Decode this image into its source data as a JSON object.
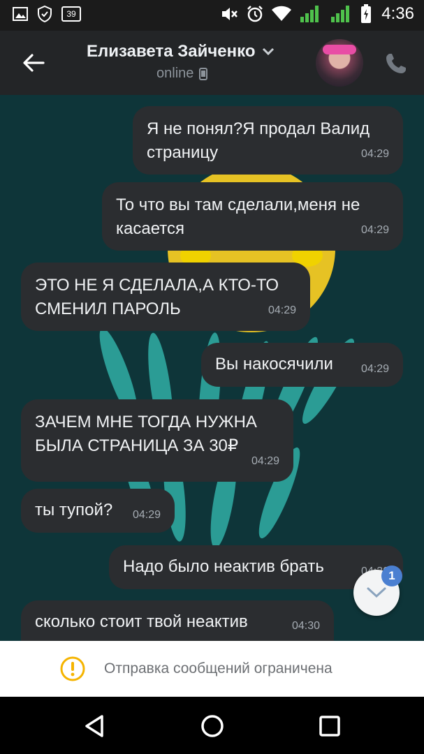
{
  "status_bar": {
    "badge": "39",
    "time": "4:36"
  },
  "header": {
    "name": "Елизавета Зайченко",
    "status": "online"
  },
  "messages": [
    {
      "text": "Я не понял?Я продал Валид страницу",
      "time": "04:29",
      "direction": "outgoing"
    },
    {
      "text": "То что вы там сделали,меня не касается",
      "time": "04:29",
      "direction": "outgoing"
    },
    {
      "text": "ЭТО НЕ Я СДЕЛАЛА,А КТО-ТО СМЕНИЛ ПАРОЛЬ",
      "time": "04:29",
      "direction": "incoming"
    },
    {
      "text": "Вы накосячили",
      "time": "04:29",
      "direction": "outgoing"
    },
    {
      "text": "ЗАЧЕМ МНЕ ТОГДА НУЖНА БЫЛА СТРАНИЦА ЗА 30₽",
      "time": "04:29",
      "direction": "incoming"
    },
    {
      "text": "ты тупой?",
      "time": "04:29",
      "direction": "incoming"
    },
    {
      "text": "Надо было неактив брать",
      "time": "04:30",
      "direction": "outgoing"
    },
    {
      "text": "сколько стоит твой неактив",
      "time": "04:30",
      "direction": "incoming"
    }
  ],
  "scroll_button": {
    "unread_count": "1"
  },
  "restriction": {
    "text": "Отправка сообщений ограничена"
  },
  "colors": {
    "header_bg": "#232527",
    "bubble_bg": "#2b2d30",
    "chat_bg": "#0f3a3e",
    "accent": "#4a7fd1",
    "warning": "#f5b400"
  },
  "icons": [
    "image-icon",
    "shield-icon",
    "mute-icon",
    "alarm-icon",
    "wifi-icon",
    "signal-icon",
    "battery-icon",
    "back-arrow-icon",
    "chevron-down-icon",
    "phone-icon",
    "call-icon",
    "warning-icon",
    "nav-back-icon",
    "nav-home-icon",
    "nav-recents-icon"
  ]
}
